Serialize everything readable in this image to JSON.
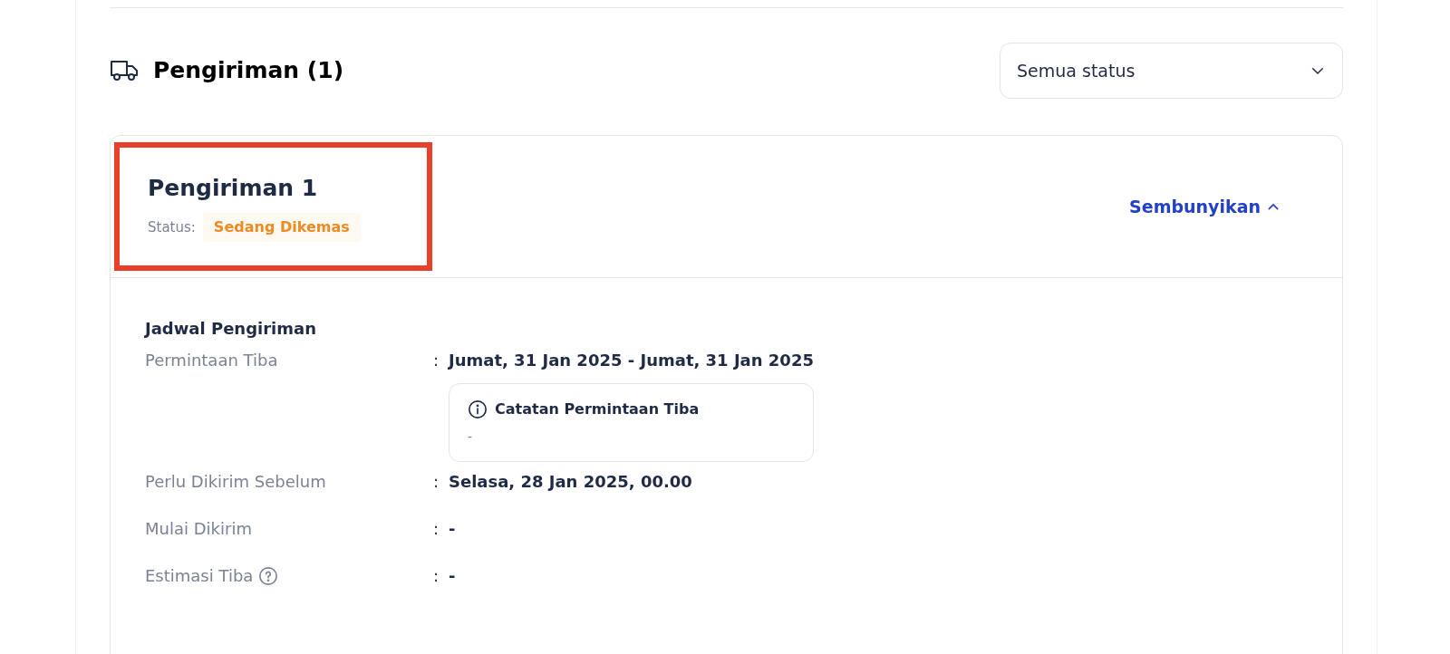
{
  "section": {
    "title": "Pengiriman (1)",
    "filter": {
      "value": "Semua status"
    }
  },
  "shipments": [
    {
      "title": "Pengiriman 1",
      "status_label": "Status:",
      "status": "Sedang Dikemas",
      "highlighted": true,
      "toggle": "Sembunyikan",
      "expanded": true,
      "schedule": {
        "title": "Jadwal Pengiriman",
        "rows": [
          {
            "label": "Permintaan Tiba",
            "help": false,
            "separator": ":",
            "value": "Jumat, 31 Jan 2025 - Jumat, 31 Jan 2025",
            "note": {
              "title": "Catatan Permintaan Tiba",
              "text": "-"
            }
          },
          {
            "label": "Perlu Dikirim Sebelum",
            "help": false,
            "separator": ":",
            "value": "Selasa, 28 Jan 2025, 00.00"
          },
          {
            "label": "Mulai Dikirim",
            "help": false,
            "separator": ":",
            "value": "-"
          },
          {
            "label": "Estimasi Tiba",
            "help": true,
            "separator": ":",
            "value": "-"
          }
        ]
      }
    }
  ]
}
